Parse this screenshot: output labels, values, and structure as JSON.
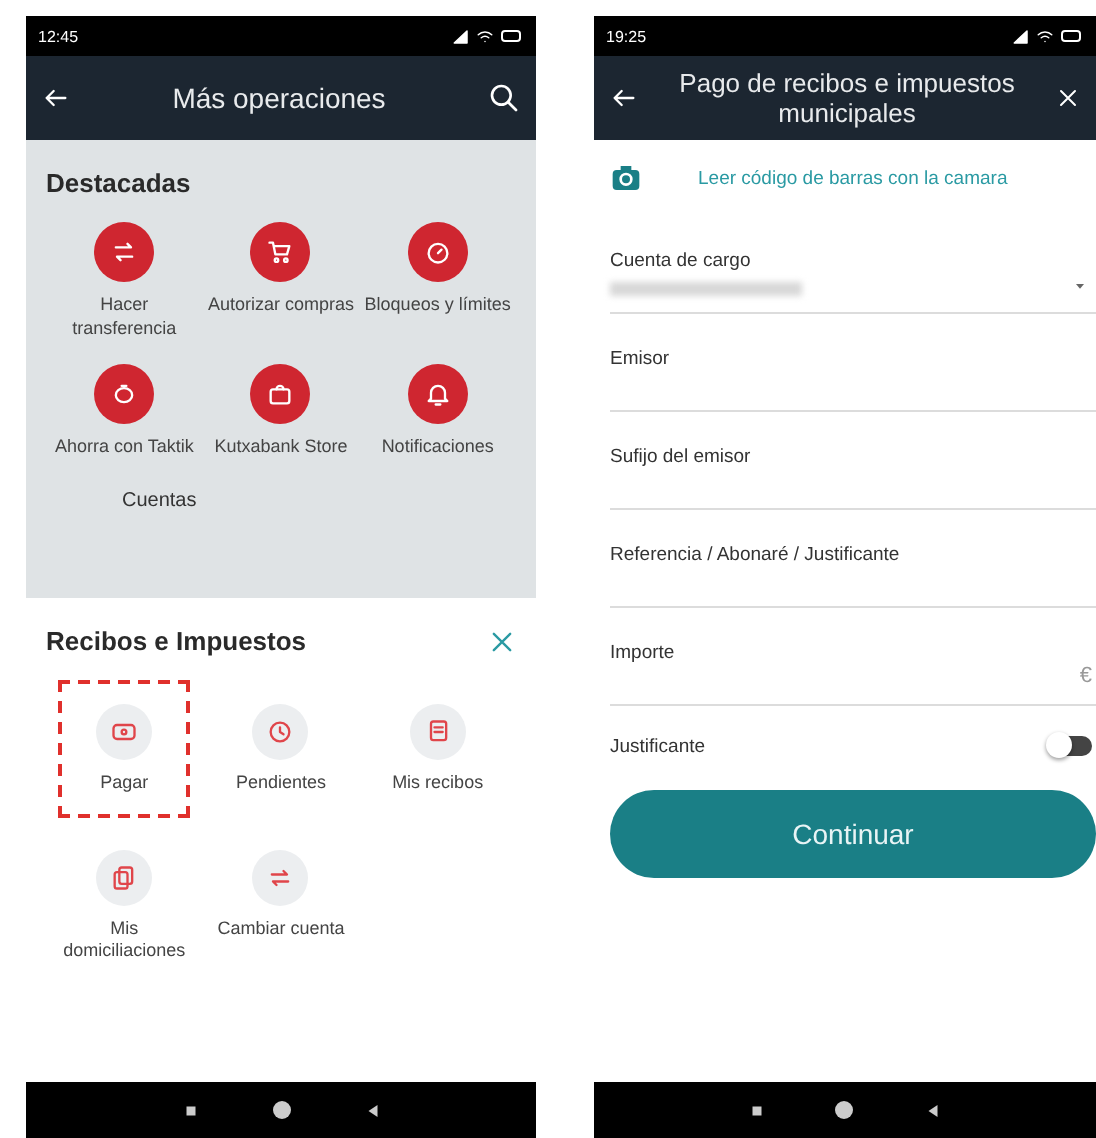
{
  "left_phone": {
    "status_bar": {
      "time": "12:45"
    },
    "header": {
      "title": "Más operaciones"
    },
    "featured": {
      "title": "Destacadas",
      "items": [
        {
          "label": "Hacer transferencia"
        },
        {
          "label": "Autorizar compras"
        },
        {
          "label": "Bloqueos y límites"
        },
        {
          "label": "Ahorra con Taktik"
        },
        {
          "label": "Kutxabank Store"
        },
        {
          "label": "Notificaciones"
        }
      ]
    },
    "next_section": {
      "title": "Cuentas"
    },
    "sheet": {
      "title": "Recibos e Impuestos",
      "items": [
        {
          "label": "Pagar",
          "selected": true
        },
        {
          "label": "Pendientes",
          "selected": false
        },
        {
          "label": "Mis recibos",
          "selected": false
        },
        {
          "label": "Mis domiciliaciones",
          "selected": false
        },
        {
          "label": "Cambiar cuenta",
          "selected": false
        }
      ]
    }
  },
  "right_phone": {
    "status_bar": {
      "time": "19:25"
    },
    "header": {
      "title": "Pago de recibos e impuestos municipales"
    },
    "scan_link": "Leer código de barras con la camara",
    "fields": [
      {
        "label": "Cuenta de cargo",
        "kind": "select"
      },
      {
        "label": "Emisor",
        "kind": "text"
      },
      {
        "label": "Sufijo del emisor",
        "kind": "text"
      },
      {
        "label": "Referencia / Abonaré / Justificante",
        "kind": "text"
      },
      {
        "label": "Importe",
        "kind": "amount",
        "suffix": "€"
      },
      {
        "label": "Justificante",
        "kind": "toggle",
        "on": false
      }
    ],
    "button": "Continuar"
  }
}
